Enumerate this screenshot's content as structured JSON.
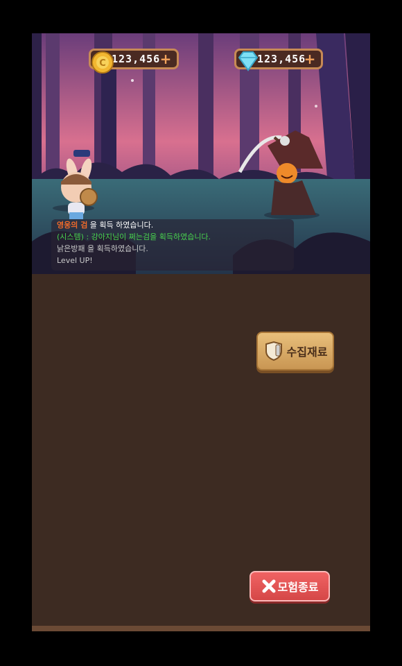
{
  "currencies": {
    "gold": {
      "value": "123,456",
      "icon": "gold-coin-icon",
      "add": "+"
    },
    "gems": {
      "value": "123,456",
      "icon": "diamond-icon",
      "add": "+"
    }
  },
  "log": {
    "line1_item": "영웅의 검",
    "line1_rest": " 을 획득 하였습니다.",
    "line2": "(시스템) : 강아지님이 쩌는검을 획득하였습니다.",
    "line3": "낡은방패 을 획득하였습니다.",
    "line4": "Level UP!"
  },
  "buttons": {
    "collect_label": "수집재료",
    "end_label": "모험종료"
  },
  "colors": {
    "panel_bg": "#3d2b22",
    "accent_orange": "#f06a2a",
    "system_green": "#48d14e",
    "end_red": "#e05252"
  }
}
